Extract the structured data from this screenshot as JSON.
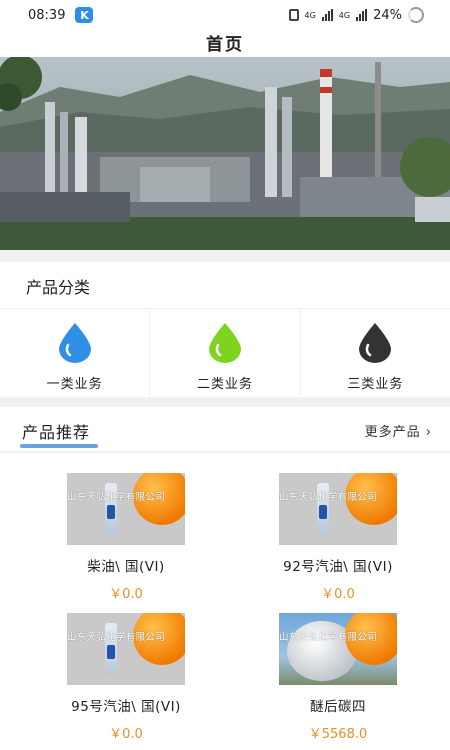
{
  "status_bar": {
    "time": "08:39",
    "app_icon_letter": "K",
    "network_a": "4G",
    "network_b": "4G",
    "battery": "24%"
  },
  "header": {
    "title": "首页"
  },
  "category": {
    "title": "产品分类",
    "items": [
      {
        "label": "一类业务",
        "color": "#2f8fe6"
      },
      {
        "label": "二类业务",
        "color": "#7ed321"
      },
      {
        "label": "三类业务",
        "color": "#333333"
      }
    ]
  },
  "recommend": {
    "title": "产品推荐",
    "more": "更多产品"
  },
  "products": [
    {
      "name": "柴油\\ 国(VI)",
      "price": "￥0.0",
      "watermark": "山东天弘化学有限公司"
    },
    {
      "name": "92号汽油\\ 国(VI)",
      "price": "￥0.0",
      "watermark": "山东天弘化学有限公司"
    },
    {
      "name": "95号汽油\\ 国(VI)",
      "price": "￥0.0",
      "watermark": "山东天弘化学有限公司"
    },
    {
      "name": "醚后碳四",
      "price": "￥5568.0",
      "watermark": "山东天弘化学有限公司"
    }
  ]
}
